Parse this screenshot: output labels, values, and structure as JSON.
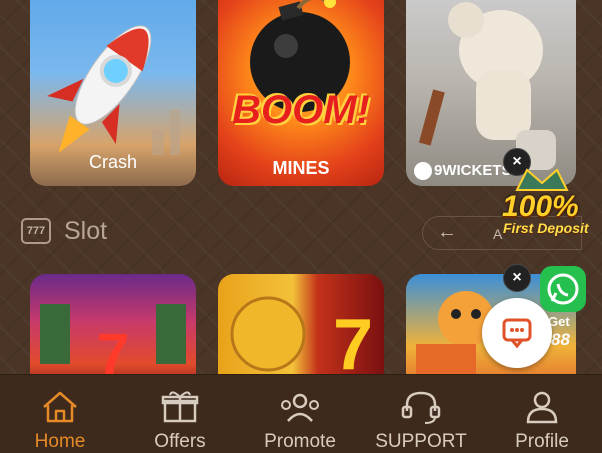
{
  "games_top": [
    {
      "label": "Crash"
    },
    {
      "label": "MINES",
      "art_text": "BOOM!"
    },
    {
      "label": "9WICKETS"
    }
  ],
  "slot_section": {
    "icon_text": "777",
    "title": "Slot",
    "back_arrow": "←",
    "all_label": "A"
  },
  "promo": {
    "amount": "100%",
    "text": "First Deposit"
  },
  "whatsapp": {
    "get": "Get",
    "number": "88"
  },
  "close_symbol": "×",
  "bottom_nav": [
    {
      "label": "Home",
      "icon": "home-icon",
      "active": true
    },
    {
      "label": "Offers",
      "icon": "gift-icon",
      "active": false
    },
    {
      "label": "Promote",
      "icon": "people-icon",
      "active": false
    },
    {
      "label": "SUPPORT",
      "icon": "headset-icon",
      "active": false
    },
    {
      "label": "Profile",
      "icon": "user-icon",
      "active": false
    }
  ],
  "colors": {
    "active_nav": "#e58a25",
    "inactive_nav": "#d8cbbf",
    "background": "#4a3526",
    "whatsapp": "#26c04f",
    "chat_icon": "#e0522a"
  }
}
